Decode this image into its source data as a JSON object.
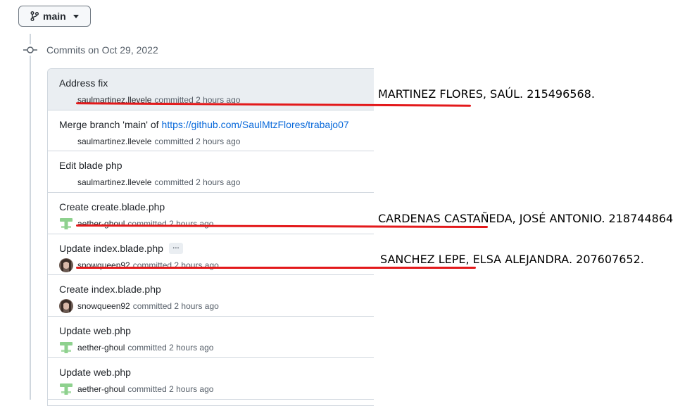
{
  "branch": {
    "label": "main"
  },
  "timeline": {
    "title": "Commits on Oct 29, 2022"
  },
  "commits": [
    {
      "message": "Address fix",
      "author": "saulmartinez.llevele",
      "time": "committed 2 hours ago",
      "avatar": "none",
      "highlight": true
    },
    {
      "message": "Merge branch 'main' of",
      "link": "https://github.com/SaulMtzFlores/trabajo07",
      "author": "saulmartinez.llevele",
      "time": "committed 2 hours ago",
      "avatar": "none"
    },
    {
      "message": "Edit blade php",
      "author": "saulmartinez.llevele",
      "time": "committed 2 hours ago",
      "avatar": "none"
    },
    {
      "message": "Create create.blade.php",
      "author": "aether-ghoul",
      "time": "committed 2 hours ago",
      "avatar": "green-identicon"
    },
    {
      "message": "Update index.blade.php",
      "ellipsis": "…",
      "author": "snowqueen92",
      "time": "committed 2 hours ago",
      "avatar": "photo"
    },
    {
      "message": "Create index.blade.php",
      "author": "snowqueen92",
      "time": "committed 2 hours ago",
      "avatar": "photo"
    },
    {
      "message": "Update web.php",
      "author": "aether-ghoul",
      "time": "committed 2 hours ago",
      "avatar": "green-identicon"
    },
    {
      "message": "Update web.php",
      "author": "aether-ghoul",
      "time": "committed 2 hours ago",
      "avatar": "green-identicon"
    }
  ],
  "annotations": [
    "MARTINEZ FLORES, SAÚL. 215496568.",
    "CARDENAS CASTAÑEDA, JOSÉ ANTONIO. 218744864.",
    "SANCHEZ LEPE, ELSA ALEJANDRA. 207607652."
  ],
  "colors": {
    "underline": "#e3191b",
    "link": "#0969da",
    "identicon": "#8ed18e"
  }
}
